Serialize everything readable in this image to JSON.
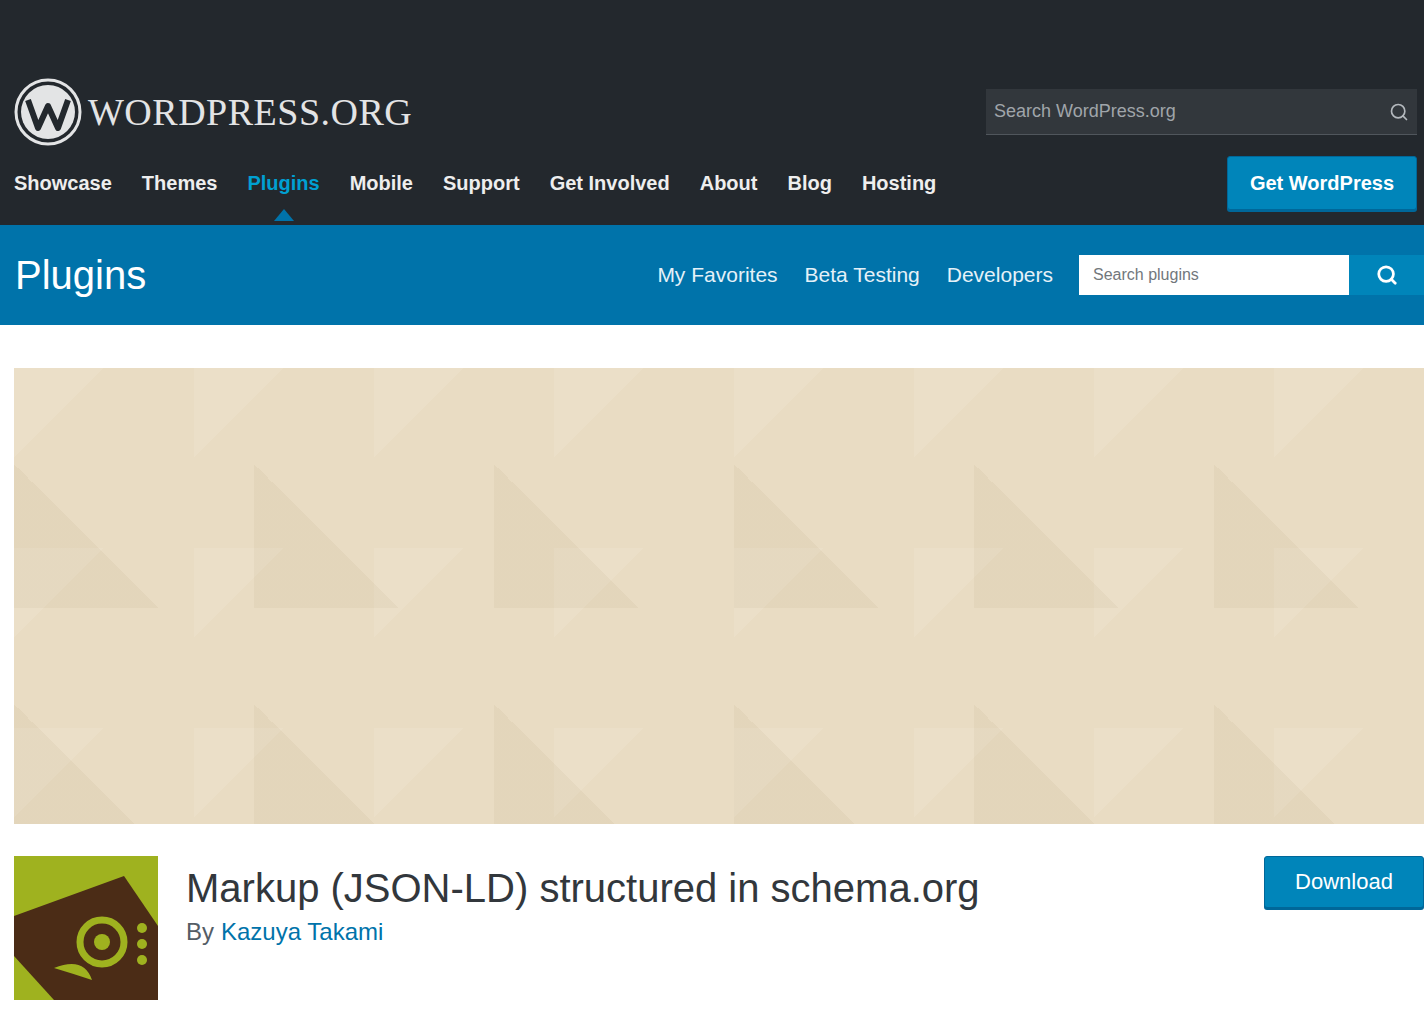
{
  "header": {
    "logo": "WORDPRESS.ORG",
    "search": {
      "placeholder": "Search WordPress.org"
    },
    "nav": [
      {
        "label": "Showcase",
        "selected": false
      },
      {
        "label": "Themes",
        "selected": false
      },
      {
        "label": "Plugins",
        "selected": true
      },
      {
        "label": "Mobile",
        "selected": false
      },
      {
        "label": "Support",
        "selected": false
      },
      {
        "label": "Get Involved",
        "selected": false
      },
      {
        "label": "About",
        "selected": false
      },
      {
        "label": "Blog",
        "selected": false
      },
      {
        "label": "Hosting",
        "selected": false
      }
    ],
    "cta": "Get WordPress"
  },
  "subnav": {
    "title": "Plugins",
    "links": [
      "My Favorites",
      "Beta Testing",
      "Developers"
    ],
    "search": {
      "placeholder": "Search plugins"
    }
  },
  "plugin": {
    "title": "Markup (JSON-LD) structured in schema.org",
    "by": "By",
    "author": "Kazuya Takami",
    "download": "Download"
  }
}
